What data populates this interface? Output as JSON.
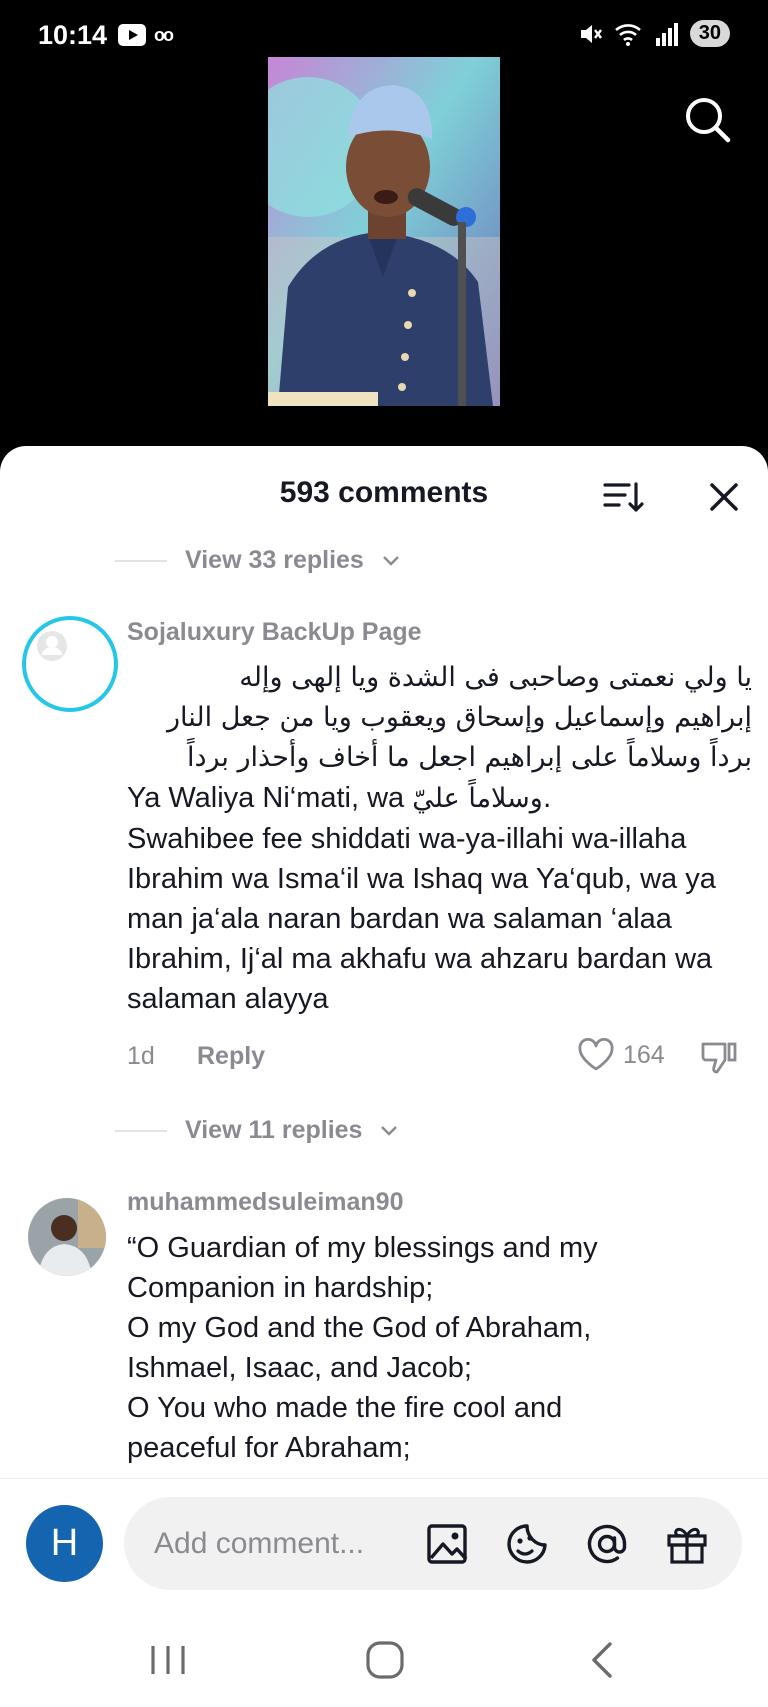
{
  "status_bar": {
    "time": "10:14",
    "battery": "30",
    "wifi_label": "5"
  },
  "comments_sheet": {
    "title": "593 comments",
    "view_replies_top": "View 33 replies",
    "view_replies_middle": "View 11 replies",
    "comments": [
      {
        "username": "Sojaluxury BackUp Page",
        "arabic_line_1": "يا ولي نعمتى وصاحبى فى الشدة ويا إلهى وإله",
        "arabic_line_2": "إبراهيم وإسماعيل وإسحاق ويعقوب ويا من جعل النار",
        "arabic_line_3": "برداً وسلاماً على إبراهيم اجعل ما أخاف وأحذار برداً",
        "arabic_line_4_ar": "وسلاماً عليّ.",
        "arabic_line_4_en": "Ya Waliya Ni‘mati, wa",
        "text": "Swahibee fee shiddati wa-ya-illahi wa-illaha Ibrahim wa Isma‘il wa Ishaq wa Ya‘qub, wa ya man ja‘ala naran bardan wa salaman ‘alaa Ibrahim, Ij‘al ma akhafu wa ahzaru bardan wa salaman alayya",
        "time": "1d",
        "reply_label": "Reply",
        "likes": "164"
      },
      {
        "username": "muhammedsuleiman90",
        "line_1": "“O Guardian of my blessings and my",
        "line_2": "Companion in hardship;",
        "line_3": "O my God and the God of Abraham,",
        "line_4": "Ishmael, Isaac, and Jacob;",
        "line_5": "O You who made the fire cool and",
        "line_6": "peaceful for Abraham;"
      }
    ]
  },
  "input_bar": {
    "user_initial": "H",
    "placeholder": "Add comment..."
  },
  "colors": {
    "accent_ring": "#25c6e6",
    "user_avatar_bg": "#1464b0",
    "muted_text": "#8a8b91"
  },
  "icons": [
    "search-icon",
    "sort-icon",
    "close-icon",
    "heart-icon",
    "dislike-icon",
    "image-icon",
    "sticker-icon",
    "mention-icon",
    "gift-icon",
    "recents-icon",
    "home-icon",
    "back-icon"
  ]
}
